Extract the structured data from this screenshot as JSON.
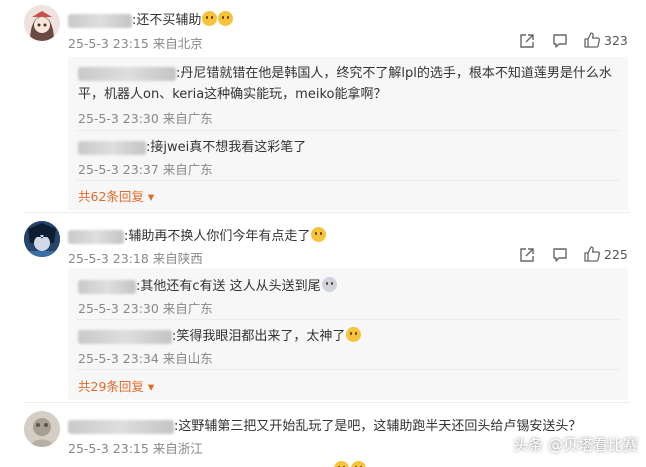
{
  "comments": [
    {
      "text": ":还不买辅助",
      "meta": "25-5-3 23:15 来自北京",
      "likes": "323",
      "replies": [
        {
          "text": ":丹尼错就错在他是韩国人，终究不了解lpl的选手，根本不知道莲男是什么水",
          "text2": "平，机器人on、keria这种确实能玩，meiko能拿啊？",
          "meta": "25-5-3 23:30 来自广东"
        },
        {
          "text": ":接jwei真不想我看这彩笔了",
          "meta": "25-5-3 23:37 来自广东"
        }
      ],
      "more": "共62条回复"
    },
    {
      "text": ":辅助再不换人你们今年有点走了",
      "meta": "25-5-3 23:18 来自陕西",
      "likes": "225",
      "replies": [
        {
          "text": ":其他还有c有送 这人从头送到尾",
          "meta": "25-5-3 23:30 来自广东"
        },
        {
          "text": ":笑得我眼泪都出来了，太神了",
          "meta": "25-5-3 23:34 来自山东"
        }
      ],
      "more": "共29条回复"
    },
    {
      "text": ":这野辅第三把又开始乱玩了是吧，这辅助跑半天还回头给卢锡安送头？",
      "meta": "25-5-3 23:15 来自浙江"
    }
  ],
  "watermark": "头条 @贝塔看比赛",
  "colors": {
    "more": "#e06a2a",
    "meta": "#888888",
    "reply_bg": "#f7f7f7"
  },
  "icons": [
    "share-icon",
    "comment-icon",
    "like-icon"
  ]
}
